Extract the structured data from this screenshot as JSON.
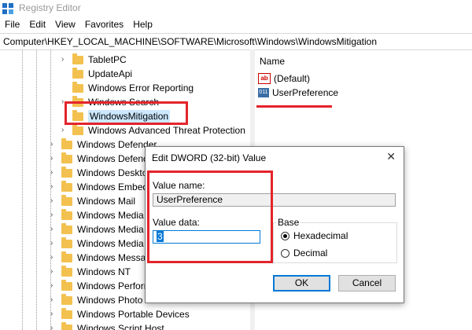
{
  "window": {
    "title": "Registry Editor",
    "app_icon": "registry-icon"
  },
  "menu": [
    "File",
    "Edit",
    "View",
    "Favorites",
    "Help"
  ],
  "address": "Computer\\HKEY_LOCAL_MACHINE\\SOFTWARE\\Microsoft\\Windows\\WindowsMitigation",
  "tree": [
    {
      "label": "TabletPC",
      "selected": false
    },
    {
      "label": "UpdateApi",
      "selected": false
    },
    {
      "label": "Windows Error Reporting",
      "selected": false
    },
    {
      "label": "Windows Search",
      "selected": false
    },
    {
      "label": "WindowsMitigation",
      "selected": true
    },
    {
      "label": "Windows Advanced Threat Protection",
      "selected": false
    },
    {
      "label": "Windows Defender",
      "selected": false
    },
    {
      "label": "Windows Defender Security Center",
      "selected": false
    },
    {
      "label": "Windows Desktop Search",
      "selected": false
    },
    {
      "label": "Windows Embedded",
      "selected": false
    },
    {
      "label": "Windows Mail",
      "selected": false
    },
    {
      "label": "Windows Media Device Manager",
      "selected": false
    },
    {
      "label": "Windows Media Foundation",
      "selected": false
    },
    {
      "label": "Windows Media Player NSS",
      "selected": false
    },
    {
      "label": "Windows Messaging Subsystem",
      "selected": false
    },
    {
      "label": "Windows NT",
      "selected": false
    },
    {
      "label": "Windows Performance Toolkit",
      "selected": false
    },
    {
      "label": "Windows Photo Viewer",
      "selected": false
    },
    {
      "label": "Windows Portable Devices",
      "selected": false
    },
    {
      "label": "Windows Script Host",
      "selected": false
    }
  ],
  "values_pane": {
    "column_name": "Name",
    "rows": [
      {
        "name": "(Default)",
        "icon": "ab-string-icon"
      },
      {
        "name": "UserPreference",
        "icon": "dword-icon"
      }
    ]
  },
  "dialog": {
    "title": "Edit DWORD (32-bit) Value",
    "close_glyph": "✕",
    "value_name_label": "Value name:",
    "value_name": "UserPreference",
    "value_data_label": "Value data:",
    "value_data": "3",
    "base_label": "Base",
    "base_options": [
      {
        "label": "Hexadecimal",
        "checked": true
      },
      {
        "label": "Decimal",
        "checked": false
      }
    ],
    "ok_label": "OK",
    "cancel_label": "Cancel"
  },
  "colors": {
    "annotation_red": "#e3242b",
    "folder": "#f3c14f",
    "selection": "#cce8ff",
    "accent": "#0078d7"
  }
}
